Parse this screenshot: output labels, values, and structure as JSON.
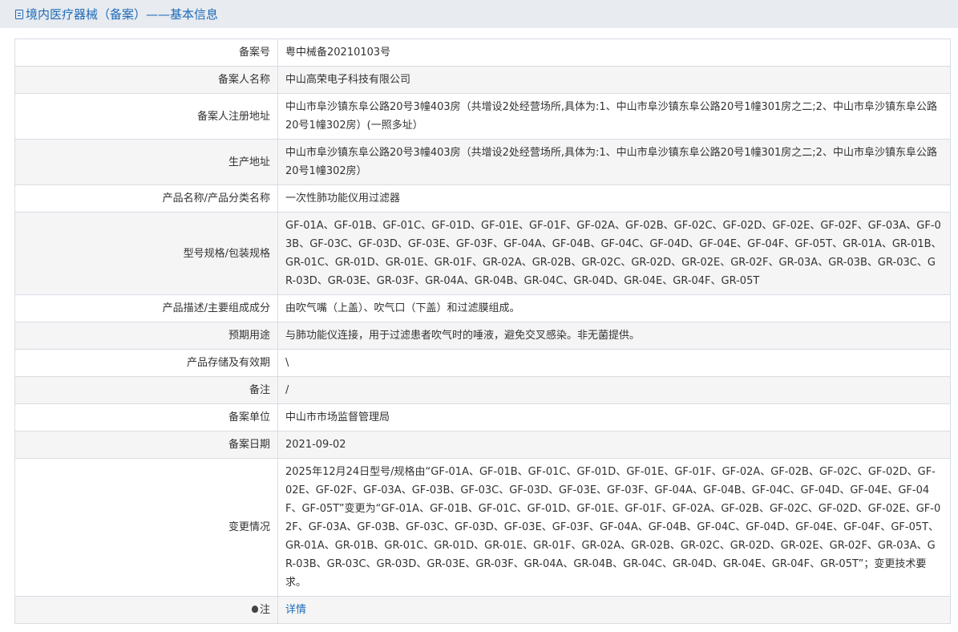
{
  "header": {
    "title": "境内医疗器械（备案）——基本信息",
    "icon": "document-icon"
  },
  "rows": [
    {
      "key": "record_number",
      "label": "备案号",
      "value": "粤中械备20210103号"
    },
    {
      "key": "filer_name",
      "label": "备案人名称",
      "value": "中山高荣电子科技有限公司"
    },
    {
      "key": "registered_address",
      "label": "备案人注册地址",
      "value": "中山市阜沙镇东阜公路20号3幢403房（共增设2处经营场所,具体为:1、中山市阜沙镇东阜公路20号1幢301房之二;2、中山市阜沙镇东阜公路20号1幢302房）(一照多址）"
    },
    {
      "key": "production_address",
      "label": "生产地址",
      "value": "中山市阜沙镇东阜公路20号3幢403房（共增设2处经营场所,具体为:1、中山市阜沙镇东阜公路20号1幢301房之二;2、中山市阜沙镇东阜公路20号1幢302房）"
    },
    {
      "key": "product_name",
      "label": "产品名称/产品分类名称",
      "value": "一次性肺功能仪用过滤器"
    },
    {
      "key": "model_spec",
      "label": "型号规格/包装规格",
      "value": "GF-01A、GF-01B、GF-01C、GF-01D、GF-01E、GF-01F、GF-02A、GF-02B、GF-02C、GF-02D、GF-02E、GF-02F、GF-03A、GF-03B、GF-03C、GF-03D、GF-03E、GF-03F、GF-04A、GF-04B、GF-04C、GF-04D、GF-04E、GF-04F、GF-05T、GR-01A、GR-01B、GR-01C、GR-01D、GR-01E、GR-01F、GR-02A、GR-02B、GR-02C、GR-02D、GR-02E、GR-02F、GR-03A、GR-03B、GR-03C、GR-03D、GR-03E、GR-03F、GR-04A、GR-04B、GR-04C、GR-04D、GR-04E、GR-04F、GR-05T"
    },
    {
      "key": "description",
      "label": "产品描述/主要组成成分",
      "value": "由吹气嘴（上盖）、吹气口（下盖）和过滤膜组成。"
    },
    {
      "key": "intended_use",
      "label": "预期用途",
      "value": "与肺功能仪连接，用于过滤患者吹气时的唾液，避免交叉感染。非无菌提供。"
    },
    {
      "key": "storage",
      "label": "产品存储及有效期",
      "value": "\\"
    },
    {
      "key": "remarks",
      "label": "备注",
      "value": "/"
    },
    {
      "key": "record_unit",
      "label": "备案单位",
      "value": "中山市市场监督管理局"
    },
    {
      "key": "record_date",
      "label": "备案日期",
      "value": "2021-09-02"
    },
    {
      "key": "changes",
      "label": "变更情况",
      "value": "2025年12月24日型号/规格由“GF-01A、GF-01B、GF-01C、GF-01D、GF-01E、GF-01F、GF-02A、GF-02B、GF-02C、GF-02D、GF-02E、GF-02F、GF-03A、GF-03B、GF-03C、GF-03D、GF-03E、GF-03F、GF-04A、GF-04B、GF-04C、GF-04D、GF-04E、GF-04F、GF-05T”变更为“GF-01A、GF-01B、GF-01C、GF-01D、GF-01E、GF-01F、GF-02A、GF-02B、GF-02C、GF-02D、GF-02E、GF-02F、GF-03A、GF-03B、GF-03C、GF-03D、GF-03E、GF-03F、GF-04A、GF-04B、GF-04C、GF-04D、GF-04E、GF-04F、GF-05T、GR-01A、GR-01B、GR-01C、GR-01D、GR-01E、GR-01F、GR-02A、GR-02B、GR-02C、GR-02D、GR-02E、GR-02F、GR-03A、GR-03B、GR-03C、GR-03D、GR-03E、GR-03F、GR-04A、GR-04B、GR-04C、GR-04D、GR-04E、GR-04F、GR-05T”；变更技术要求。"
    }
  ],
  "note": {
    "label": "注",
    "icon": "lightbulb-icon",
    "link_text": "详情"
  },
  "colors": {
    "accent": "#1e6bb8",
    "header_bg": "#e8ebf0",
    "row_alt_bg": "#f5f5f5",
    "border": "#d8dde3"
  }
}
